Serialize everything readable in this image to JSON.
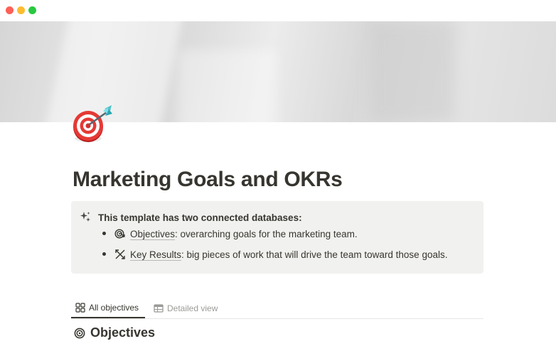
{
  "window": {
    "controls": [
      "close",
      "minimize",
      "maximize"
    ]
  },
  "page": {
    "icon": "target-dart-icon",
    "title": "Marketing Goals and OKRs"
  },
  "callout": {
    "icon": "sparkles-icon",
    "heading": "This template has two connected databases:",
    "items": [
      {
        "icon": "target-arrow-icon",
        "link": "Objectives",
        "text": ": overarching goals for the marketing team."
      },
      {
        "icon": "crossed-arrows-icon",
        "link": "Key Results",
        "text": ": big pieces of work that will drive the team toward those goals."
      }
    ]
  },
  "tabs": [
    {
      "label": "All objectives",
      "icon": "gallery-icon",
      "active": true
    },
    {
      "label": "Detailed view",
      "icon": "table-icon",
      "active": false
    }
  ],
  "section": {
    "icon": "target-icon",
    "title": "Objectives"
  },
  "colors": {
    "text": "#37352f",
    "muted": "#9b9a97",
    "callout_bg": "#f1f1ef",
    "close": "#fe5f57",
    "minimize": "#febc2e",
    "maximize": "#28c840"
  }
}
